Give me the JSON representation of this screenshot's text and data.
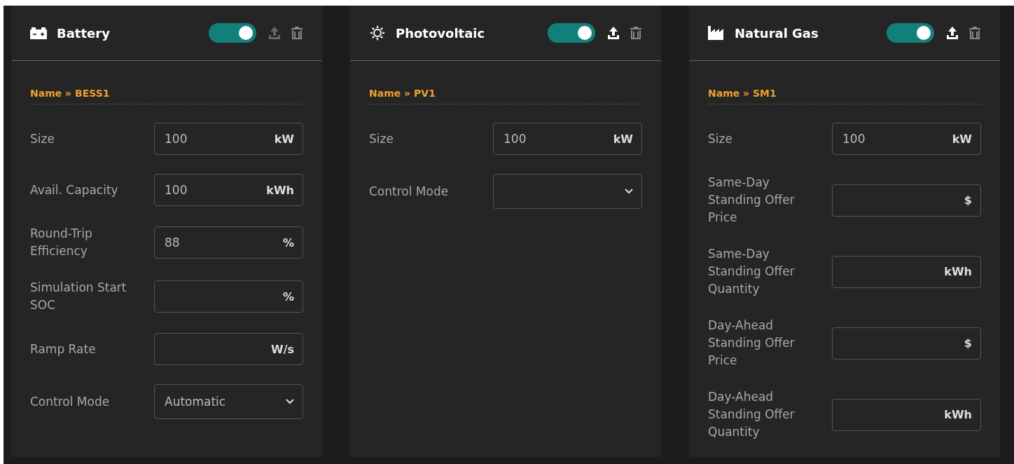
{
  "panels": [
    {
      "kind": "battery",
      "title": "Battery",
      "enabled": true,
      "upload_disabled": true,
      "name_label": "Name » BESS1",
      "fields": [
        {
          "kind": "input",
          "label": "Size",
          "value": "100",
          "unit": "kW"
        },
        {
          "kind": "input",
          "label": "Avail. Capacity",
          "value": "100",
          "unit": "kWh"
        },
        {
          "kind": "input",
          "label": "Round-Trip Efficiency",
          "value": "88",
          "unit": "%"
        },
        {
          "kind": "input",
          "label": "Simulation Start SOC",
          "unit": "%"
        },
        {
          "kind": "input",
          "label": "Ramp Rate",
          "unit": "W/s"
        },
        {
          "kind": "select",
          "label": "Control Mode",
          "value": "Automatic"
        }
      ]
    },
    {
      "kind": "sun",
      "title": "Photovoltaic",
      "enabled": true,
      "upload_disabled": false,
      "name_label": "Name » PV1",
      "fields": [
        {
          "kind": "input",
          "label": "Size",
          "value": "100",
          "unit": "kW"
        },
        {
          "kind": "select",
          "label": "Control Mode"
        }
      ]
    },
    {
      "kind": "factory",
      "title": "Natural Gas",
      "enabled": true,
      "upload_disabled": false,
      "name_label": "Name » SM1",
      "fields": [
        {
          "kind": "input",
          "label": "Size",
          "value": "100",
          "unit": "kW"
        },
        {
          "kind": "input",
          "label": "Same-Day Standing Offer Price",
          "unit": "$"
        },
        {
          "kind": "input",
          "label": "Same-Day Standing Offer Quantity",
          "unit": "kWh"
        },
        {
          "kind": "input",
          "label": "Day-Ahead Standing Offer Price",
          "unit": "$"
        },
        {
          "kind": "input",
          "label": "Day-Ahead Standing Offer Quantity",
          "unit": "kWh"
        }
      ]
    }
  ]
}
